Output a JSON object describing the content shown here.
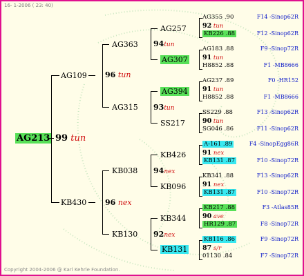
{
  "header": "16- 1-2006 ( 23: 40)",
  "footer": "Copyright 2004-2006 @ Karl Kehrle Foundation.",
  "root": {
    "name": "AG213",
    "num": "99",
    "tag": "tun"
  },
  "gen1": [
    {
      "name": "AG109",
      "num": "96",
      "tag": "tun"
    },
    {
      "name": "KB430",
      "num": "96",
      "tag": "nex"
    }
  ],
  "gen2": [
    {
      "name": "AG363",
      "num": "94",
      "tag": "tun"
    },
    {
      "name": "AG315",
      "num": "93",
      "tag": "tun"
    },
    {
      "name": "KB038",
      "num": "94",
      "tag": "nex"
    },
    {
      "name": "KB130",
      "num": "92",
      "tag": "nex"
    }
  ],
  "gen3": [
    {
      "name": "AG257"
    },
    {
      "name": "AG307"
    },
    {
      "name": "AG394"
    },
    {
      "name": "SS217"
    },
    {
      "name": "KB426"
    },
    {
      "name": "KB096"
    },
    {
      "name": "KB344"
    },
    {
      "name": "KB131"
    }
  ],
  "gen4": [
    {
      "a": "AG355 .90",
      "num": "92",
      "tag": "tun",
      "b": "KB226 .88",
      "ia": "F14 -Sinop62R",
      "ib": "F12 -Sinop62R"
    },
    {
      "a": "AG183 .88",
      "num": "91",
      "tag": "tun",
      "b": "H8852 .88",
      "ia": "F9 -Sinop72R",
      "ib": "F1 -MB8666"
    },
    {
      "a": "AG237 .89",
      "num": "91",
      "tag": "tun",
      "b": "H8852 .88",
      "ia": "F0 -HR152",
      "ib": "F1 -MB8666"
    },
    {
      "a": "SS229 .88",
      "num": "90",
      "tag": "tun",
      "b": "SG046 .86",
      "ia": "F13 -Sinop62R",
      "ib": "F11 -Sinop62R"
    },
    {
      "a": "A-161 .89",
      "num": "91",
      "tag": "nex",
      "b": "KB131 .87",
      "ia": "F4 -SinopEgg86R",
      "ib": "F10 -Sinop72R"
    },
    {
      "a": "KB341 .88",
      "num": "91",
      "tag": "nex",
      "b": "KB131 .87",
      "ia": "F13 -Sinop62R",
      "ib": "F10 -Sinop72R"
    },
    {
      "a": "KB217 .88",
      "num": "90",
      "tag": "ave",
      "b": "HR129 .87",
      "ia": "F3 -Atlas85R",
      "ib": "F8 -Sinop72R"
    },
    {
      "a": "KB116 .86",
      "num": "87",
      "tag": "s/r",
      "b": "01130 .84",
      "ia": "F9 -Sinop72R",
      "ib": "F7 -Sinop72R"
    }
  ],
  "colors": {
    "border": "#e0108f",
    "green": "#58e058",
    "cyan": "#38e8f0",
    "info": "#0a18c8",
    "tag": "#d01010"
  }
}
